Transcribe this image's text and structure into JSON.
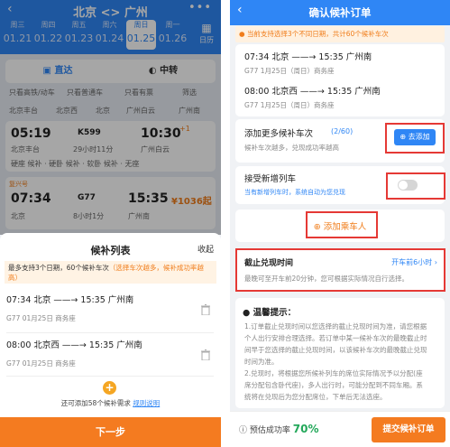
{
  "left": {
    "header": {
      "back_icon": "‹",
      "title": "北京 <> 广州",
      "more_icon": "•••"
    },
    "dates": [
      {
        "weekday": "周三",
        "date": "01.21"
      },
      {
        "weekday": "周四",
        "date": "01.22"
      },
      {
        "weekday": "周五",
        "date": "01.23"
      },
      {
        "weekday": "周六",
        "date": "01.24"
      },
      {
        "weekday": "周日",
        "date": "01.25"
      },
      {
        "weekday": "周一",
        "date": "01.26"
      }
    ],
    "calendar_label": "日历",
    "tabs": {
      "direct": "直达",
      "transfer": "中转"
    },
    "filters": [
      "只看高铁/动车",
      "只看普通车",
      "只看有票",
      "筛选"
    ],
    "stations": [
      "北京丰台",
      "北京西",
      "北京",
      "广州白云",
      "广州南"
    ],
    "train1": {
      "depart": "05:19",
      "number": "K599",
      "arrive": "10:30",
      "arrive_sup": "+1",
      "from": "北京丰台",
      "duration": "29小时11分",
      "to": "广州白云",
      "seats": "硬座 候补 · 硬卧 候补 · 软卧 候补 · 无座"
    },
    "train2": {
      "tag": "复兴号",
      "depart": "07:34",
      "number": "G77",
      "arrive": "15:35",
      "price": "¥1036起",
      "from": "北京",
      "duration": "8小时1分",
      "to": "广州南"
    },
    "sheet": {
      "title": "候补列表",
      "collapse": "收起",
      "notice_prefix": "最多支持3个日期，60个候补车次",
      "notice_highlight": "（选择车次越多，候补成功率越高）",
      "trips": [
        {
          "route": "07:34 北京 ——→ 15:35 广州南",
          "detail": "G77  01月25日  商务座"
        },
        {
          "route": "08:00 北京西 ——→ 15:35 广州南",
          "detail": "G77  01月25日  商务座"
        }
      ],
      "add_icon": "+",
      "add_note": "还可添加58个候补需求",
      "rules_link": "规则说明",
      "next_button": "下一步"
    }
  },
  "right": {
    "header": {
      "back_icon": "‹",
      "title": "确认候补订单"
    },
    "notice": "当前支持选择3个不同日期，共计60个候补车次",
    "trips": [
      {
        "route": "07:34 北京 ——→ 15:35 广州南",
        "detail": "G77  1月25日（周日）商务座"
      },
      {
        "route": "08:00 北京西 ——→ 15:35 广州南",
        "detail": "G77  1月25日（周日）商务座"
      }
    ],
    "add_more": {
      "title": "添加更多候补车次",
      "count": "(2/60)",
      "desc": "候补车次越多，兑现成功率越高",
      "button": "去添加"
    },
    "accept_new": {
      "title": "接受新增列车",
      "desc": "当有新增列车时，系统自动为您兑现"
    },
    "add_passenger": "添加乘车人",
    "deadline": {
      "title": "截止兑现时间",
      "value": "开车前6小时",
      "desc": "最晚可至开车前20分钟，您可根据实际情况自行选择。"
    },
    "tips": {
      "title": "温馨提示：",
      "lines": [
        "1.订单截止兑现时间以您选择的截止兑现时间为准，请您根据",
        "个人出行安排合理选择。若订单中某一候补车次的最晚截止时",
        "间早于您选择的截止兑现时间，以该候补车次的最晚截止兑现",
        "时间为准。",
        "2.兑现时，将根据您所候补列车的席位实际情况予以分配(座",
        "席分配包含卧代座)，多人出行时，可能分配到不同车厢。系",
        "统将在兑现后为您分配席位，下单后无法选座。"
      ]
    },
    "footer": {
      "info_icon": "ⓘ",
      "rate_label": "预估成功率",
      "rate_value": "70%",
      "submit": "提交候补订单"
    }
  }
}
